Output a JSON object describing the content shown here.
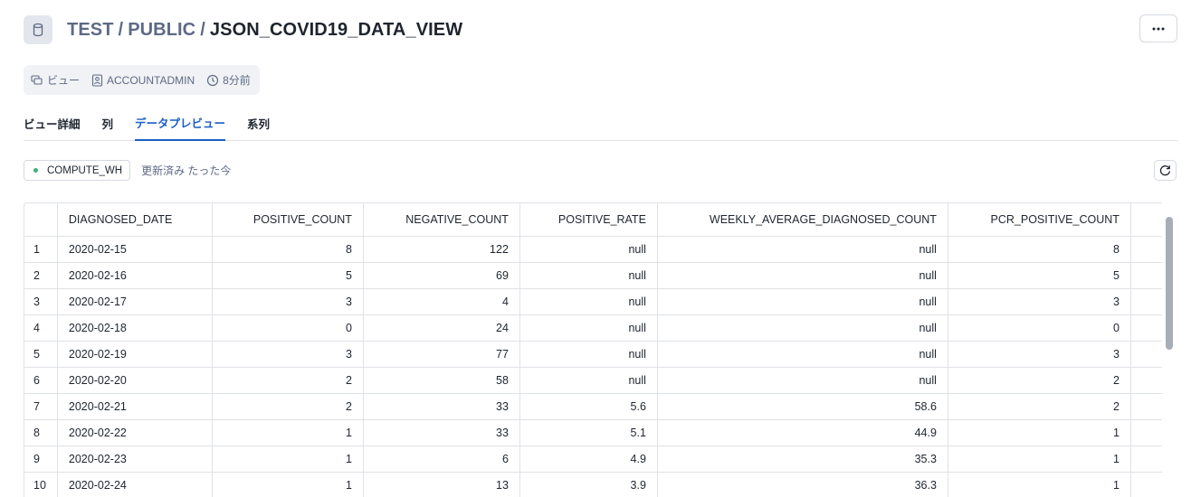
{
  "header": {
    "crumb1": "TEST",
    "crumb2": "PUBLIC",
    "separator": "/",
    "title": "JSON_COVID19_DATA_VIEW",
    "icon": "database-icon",
    "more_label": "···"
  },
  "meta": {
    "type_label": "ビュー",
    "owner": "ACCOUNTADMIN",
    "updated": "8分前"
  },
  "tabs": [
    {
      "label": "ビュー詳細",
      "active": false
    },
    {
      "label": "列",
      "active": false
    },
    {
      "label": "データプレビュー",
      "active": true
    },
    {
      "label": "系列",
      "active": false
    }
  ],
  "toolbar": {
    "warehouse": "COMPUTE_WH",
    "refreshed": "更新済み たった今",
    "status_color": "#3bb273"
  },
  "table": {
    "columns": [
      "",
      "DIAGNOSED_DATE",
      "POSITIVE_COUNT",
      "NEGATIVE_COUNT",
      "POSITIVE_RATE",
      "WEEKLY_AVERAGE_DIAGNOSED_COUNT",
      "PCR_POSITIVE_COUNT"
    ],
    "rows": [
      [
        "1",
        "2020-02-15",
        "8",
        "122",
        "null",
        "null",
        "8"
      ],
      [
        "2",
        "2020-02-16",
        "5",
        "69",
        "null",
        "null",
        "5"
      ],
      [
        "3",
        "2020-02-17",
        "3",
        "4",
        "null",
        "null",
        "3"
      ],
      [
        "4",
        "2020-02-18",
        "0",
        "24",
        "null",
        "null",
        "0"
      ],
      [
        "5",
        "2020-02-19",
        "3",
        "77",
        "null",
        "null",
        "3"
      ],
      [
        "6",
        "2020-02-20",
        "2",
        "58",
        "null",
        "null",
        "2"
      ],
      [
        "7",
        "2020-02-21",
        "2",
        "33",
        "5.6",
        "58.6",
        "2"
      ],
      [
        "8",
        "2020-02-22",
        "1",
        "33",
        "5.1",
        "44.9",
        "1"
      ],
      [
        "9",
        "2020-02-23",
        "1",
        "6",
        "4.9",
        "35.3",
        "1"
      ],
      [
        "10",
        "2020-02-24",
        "1",
        "13",
        "3.9",
        "36.3",
        "1"
      ]
    ]
  },
  "colors": {
    "accent": "#1a5ec7",
    "muted_text": "#5d6a85",
    "border": "#dfe2e7"
  }
}
